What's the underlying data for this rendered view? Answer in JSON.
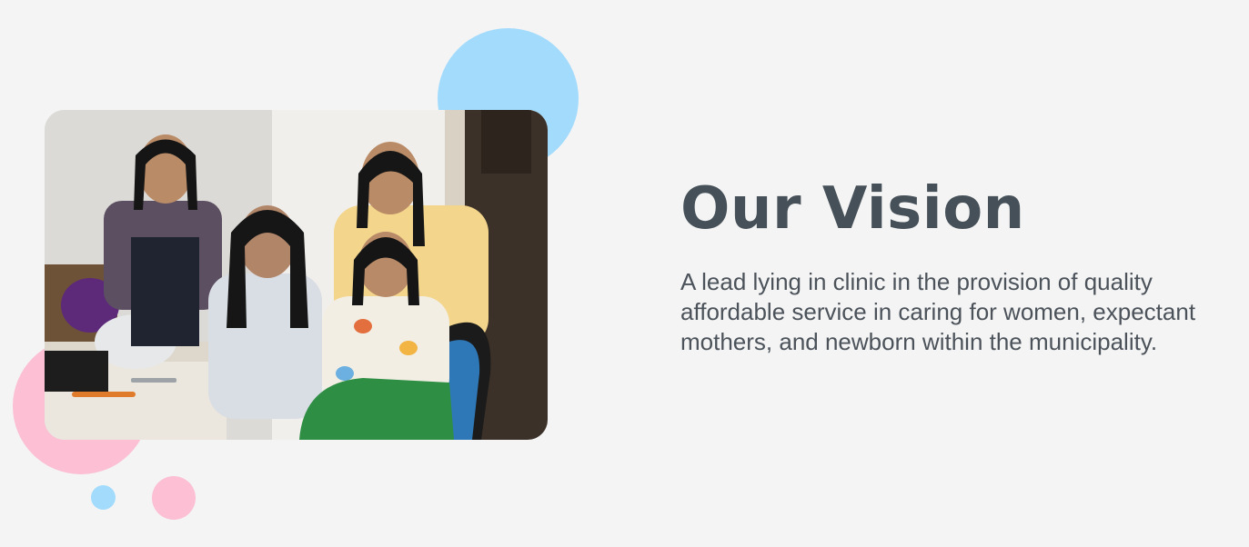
{
  "vision": {
    "title": "Our Vision",
    "description": "A lead lying in clinic in the provision of quality affordable service in caring for women, expectant mothers, and newborn within the municipality."
  },
  "colors": {
    "background": "#f4f4f4",
    "heading": "#465058",
    "text": "#4b525a",
    "accent_blue": "#a3dbfd",
    "accent_pink": "#fcbfd3"
  }
}
